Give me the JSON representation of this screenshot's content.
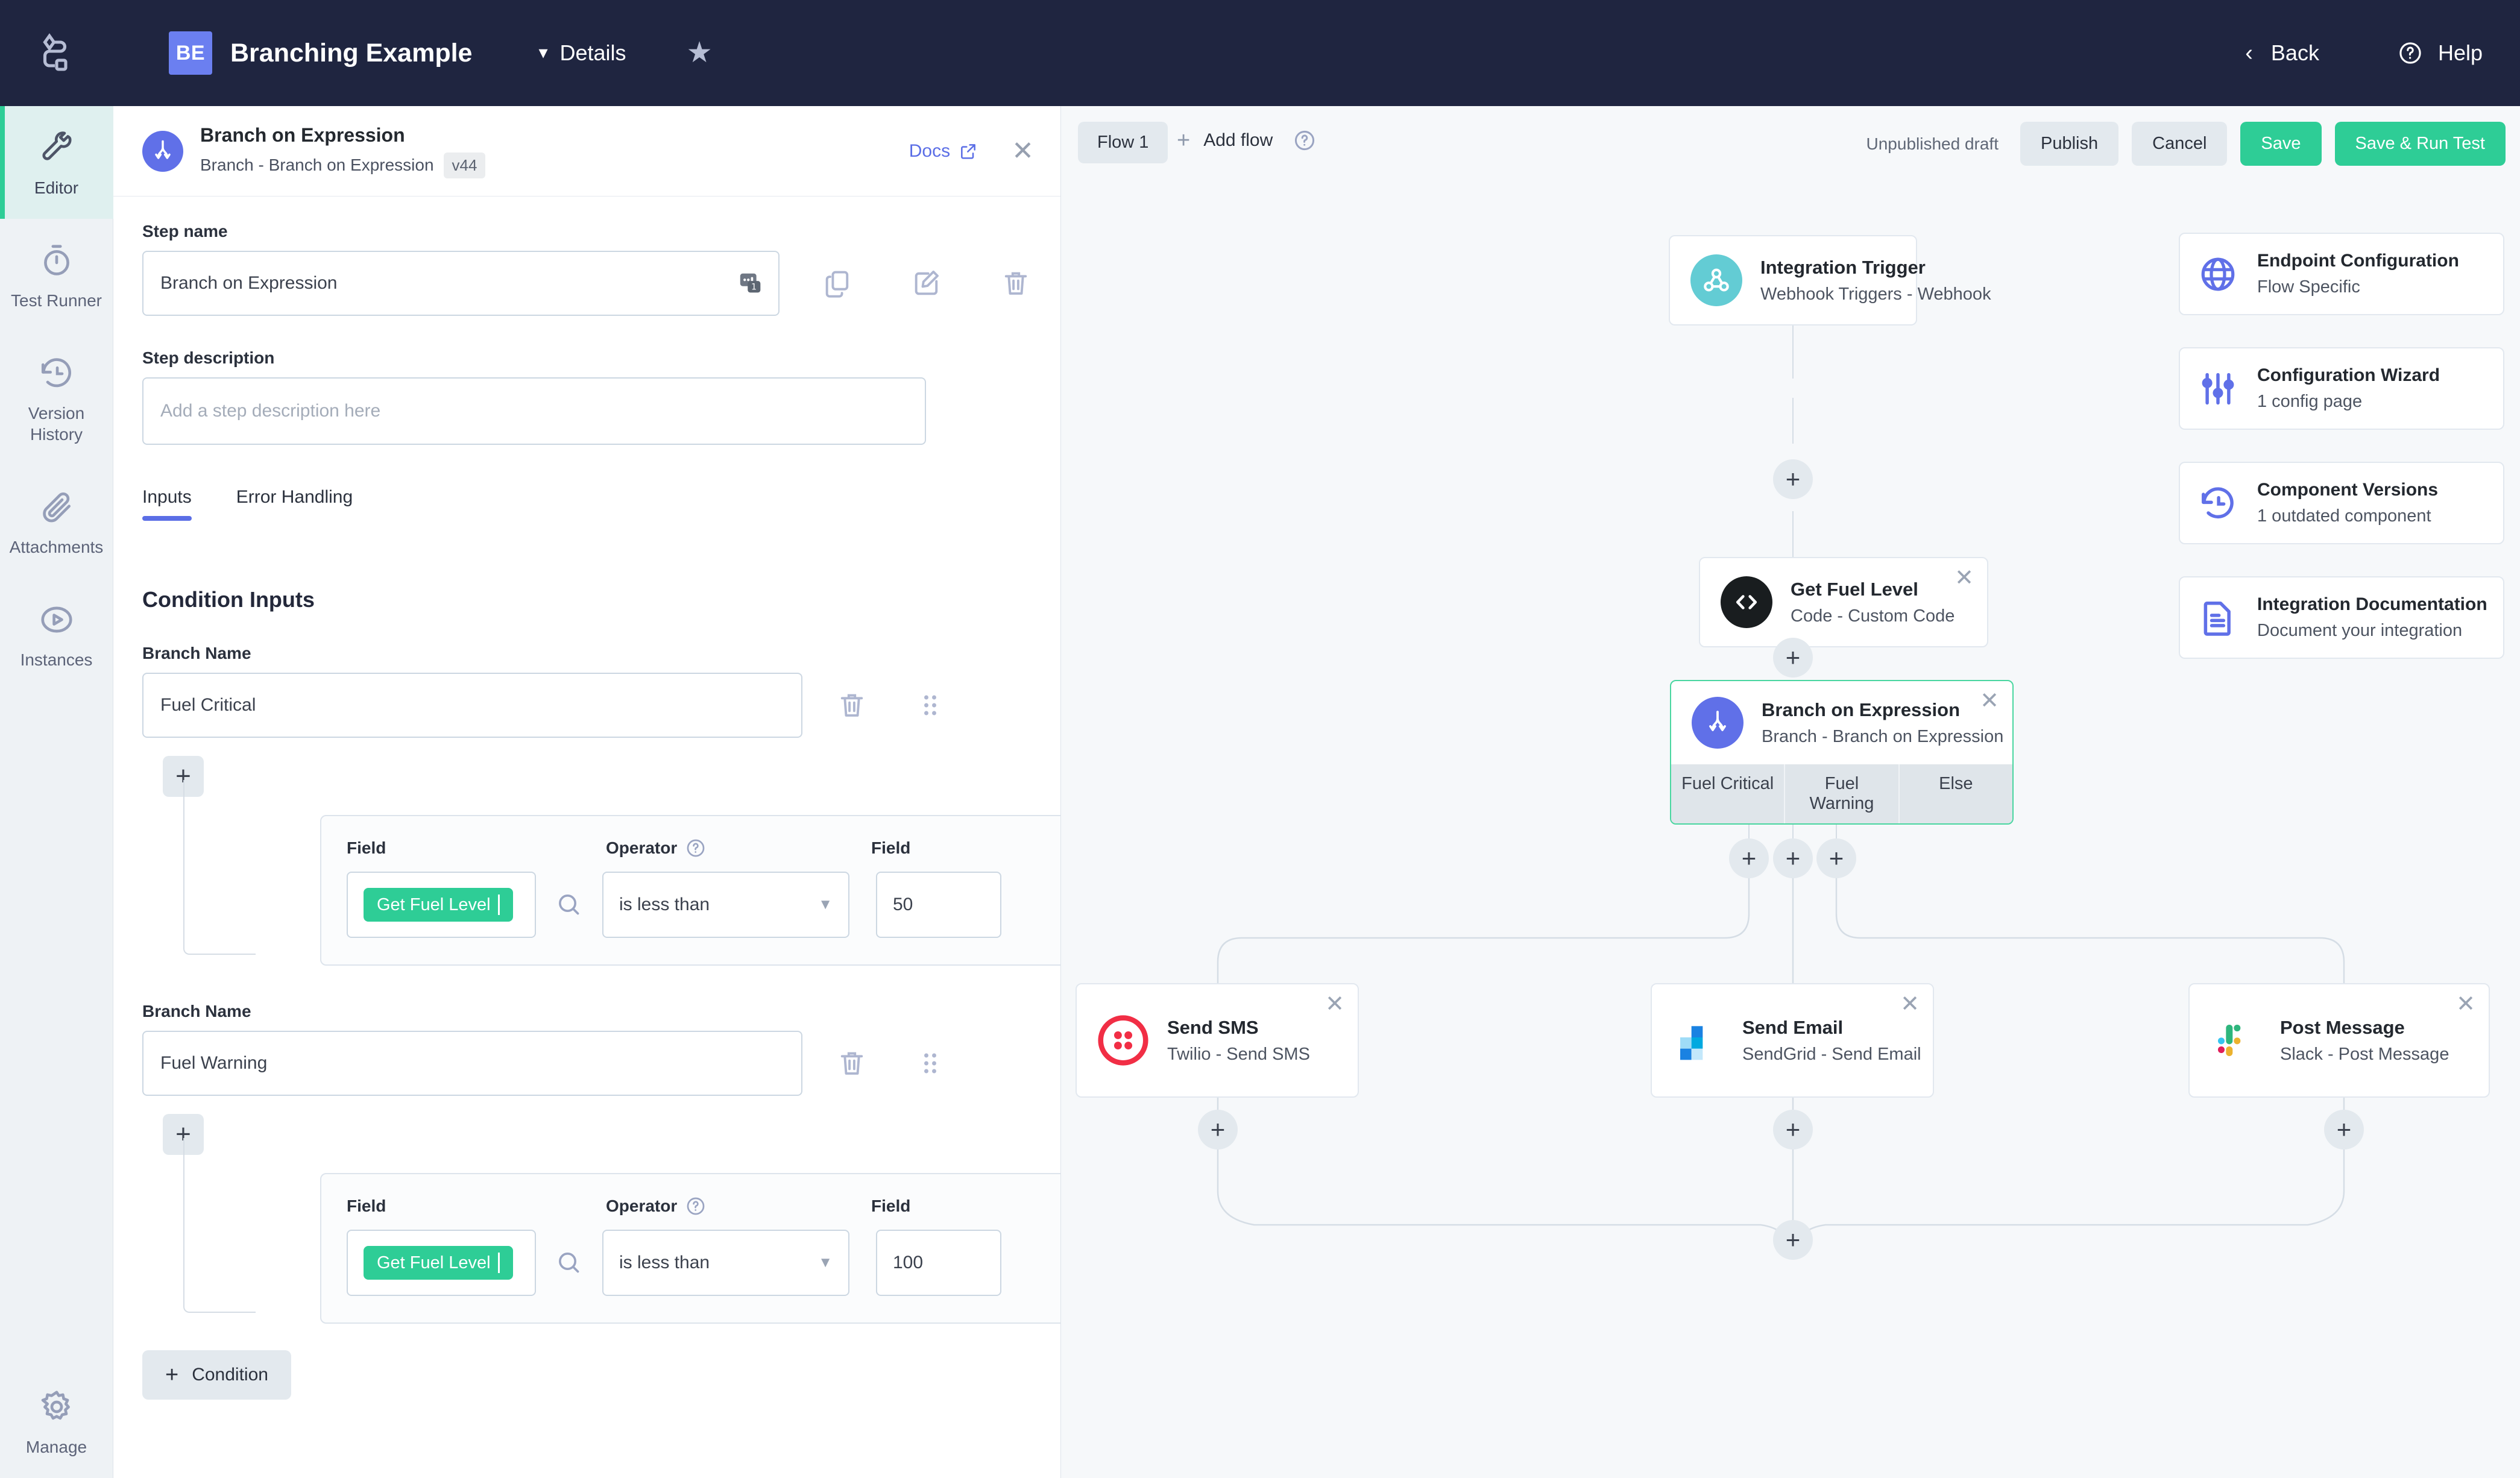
{
  "topbar": {
    "logo_icon": "flow-logo-icon",
    "avatar_initials": "BE",
    "title": "Branching Example",
    "details_label": "Details",
    "details_caret_icon": "chevron-down-icon",
    "star_icon": "star-icon",
    "back_label": "Back",
    "back_icon": "chevron-left-icon",
    "help_label": "Help",
    "help_icon": "question-circle-icon"
  },
  "rail": {
    "items": [
      {
        "label": "Editor",
        "icon": "wrench-icon",
        "active": true
      },
      {
        "label": "Test Runner",
        "icon": "stopwatch-icon",
        "active": false
      },
      {
        "label": "Version History",
        "icon": "history-clock-icon",
        "active": false
      },
      {
        "label": "Attachments",
        "icon": "paperclip-icon",
        "active": false
      },
      {
        "label": "Instances",
        "icon": "play-circle-icon",
        "active": false
      }
    ],
    "bottom": {
      "label": "Manage",
      "icon": "gear-icon"
    }
  },
  "panel": {
    "header": {
      "icon": "branch-icon",
      "title": "Branch on Expression",
      "subtitle": "Branch - Branch on Expression",
      "version": "v44",
      "docs_label": "Docs",
      "docs_icon": "external-link-icon",
      "close_icon": "close-icon"
    },
    "step_name_label": "Step name",
    "step_name_value": "Branch on Expression",
    "step_name_badge_icon": "step-index-badge-icon",
    "copy_icon": "copy-icon",
    "edit_icon": "edit-pencil-icon",
    "delete_icon": "trash-icon",
    "step_description_label": "Step description",
    "step_description_placeholder": "Add a step description here",
    "step_description_value": "",
    "tabs": [
      {
        "label": "Inputs",
        "active": true
      },
      {
        "label": "Error Handling",
        "active": false
      }
    ],
    "section_title": "Condition Inputs",
    "branch_name_label": "Branch Name",
    "field_label": "Field",
    "operator_label": "Operator",
    "operator_help_icon": "question-circle-icon",
    "search_icon": "search-icon",
    "branch_trash_icon": "trash-icon",
    "branch_drag_icon": "drag-handle-icon",
    "plus_icon": "plus-icon",
    "branches": [
      {
        "name": "Fuel Critical",
        "condition": {
          "field_chip": "Get Fuel Level",
          "operator": "is less than",
          "value": "50"
        }
      },
      {
        "name": "Fuel Warning",
        "condition": {
          "field_chip": "Get Fuel Level",
          "operator": "is less than",
          "value": "100"
        }
      }
    ],
    "add_condition_label": "Condition"
  },
  "canvas": {
    "toolbar": {
      "flow_tab": "Flow 1",
      "add_flow_label": "Add flow",
      "add_flow_help_icon": "question-circle-icon",
      "draft_status": "Unpublished draft",
      "publish_label": "Publish",
      "cancel_label": "Cancel",
      "save_label": "Save",
      "save_run_label": "Save & Run Test"
    },
    "nodes": [
      {
        "title": "Integration Trigger",
        "subtitle": "Webhook Triggers - Webhook",
        "icon": "webhook-icon",
        "closable": false
      },
      {
        "title": "Get Fuel Level",
        "subtitle": "Code - Custom Code",
        "icon": "code-icon",
        "closable": true
      },
      {
        "title": "Send SMS",
        "subtitle": "Twilio - Send SMS",
        "icon": "twilio-icon",
        "closable": true
      },
      {
        "title": "Send Email",
        "subtitle": "SendGrid - Send Email",
        "icon": "sendgrid-icon",
        "closable": true
      },
      {
        "title": "Post Message",
        "subtitle": "Slack - Post Message",
        "icon": "slack-icon",
        "closable": true
      }
    ],
    "branch_node": {
      "title": "Branch on Expression",
      "subtitle": "Branch - Branch on Expression",
      "icon": "branch-icon",
      "close_icon": "close-icon",
      "tabs": [
        "Fuel Critical",
        "Fuel Warning",
        "Else"
      ]
    },
    "side_cards": [
      {
        "title": "Endpoint Configuration",
        "subtitle": "Flow Specific",
        "icon": "globe-icon"
      },
      {
        "title": "Configuration Wizard",
        "subtitle": "1 config page",
        "icon": "sliders-icon"
      },
      {
        "title": "Component Versions",
        "subtitle": "1 outdated component",
        "icon": "history-clock-icon"
      },
      {
        "title": "Integration Documentation",
        "subtitle": "Document your integration",
        "icon": "document-icon"
      }
    ]
  },
  "colors": {
    "topbar_bg": "#1f2540",
    "accent_blue": "#5b6ee6",
    "accent_green": "#2ecd96",
    "rail_bg": "#eef2f5",
    "rail_active_bg": "#dff0ef",
    "canvas_bg": "#f6f8fa"
  }
}
